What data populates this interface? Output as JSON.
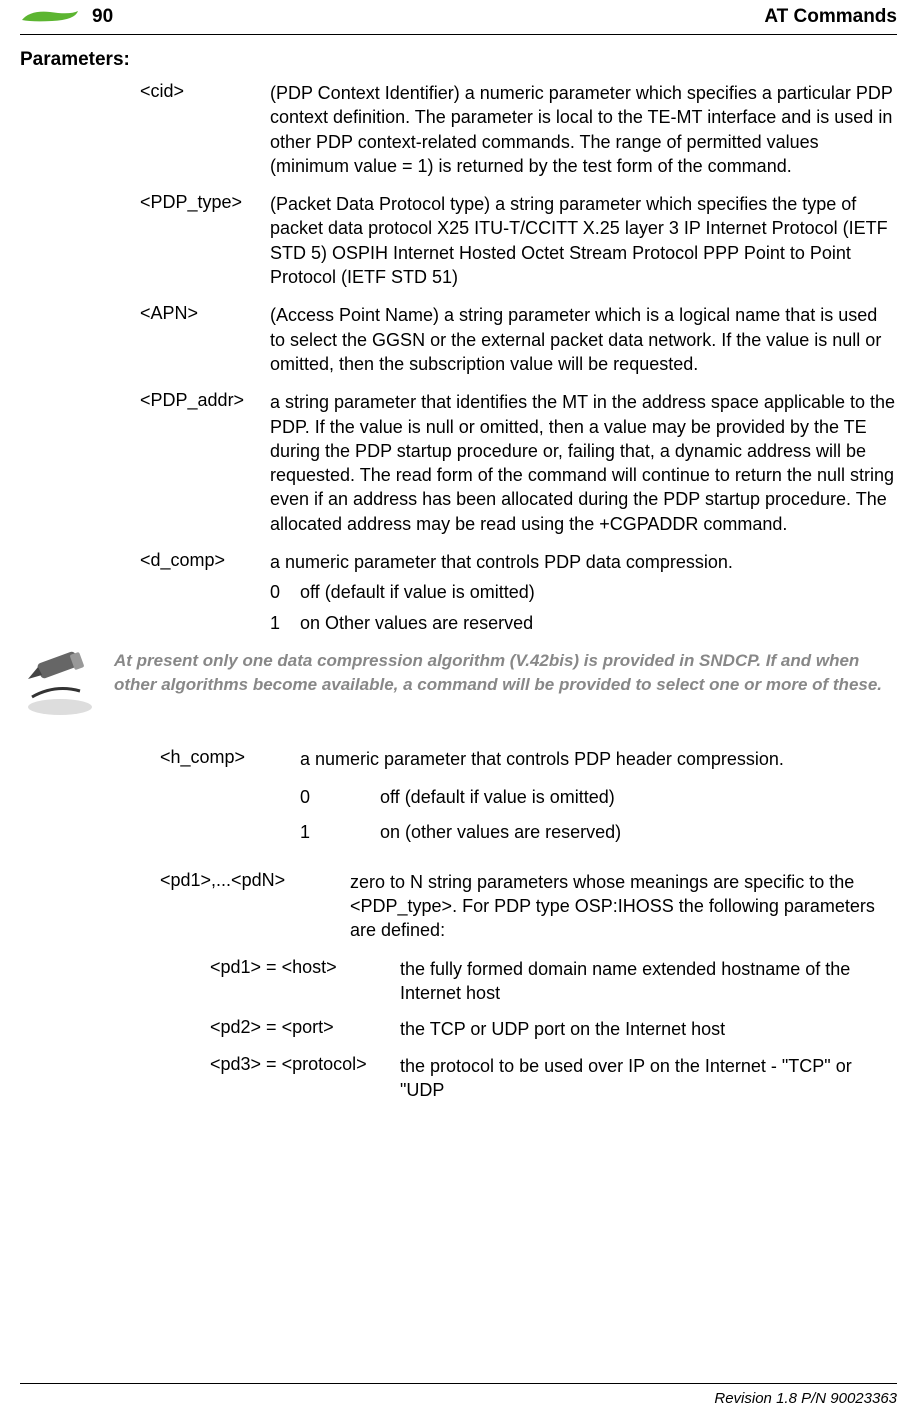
{
  "header": {
    "page_number": "90",
    "section_title": "AT Commands"
  },
  "headings": {
    "parameters": "Parameters:"
  },
  "params": {
    "cid": {
      "name": "<cid>",
      "desc": "(PDP Context Identifier) a numeric parameter which specifies a particular PDP context definition. The parameter is local to the TE-MT interface and is used in other PDP context-related commands. The range of permitted values (minimum value = 1) is returned by the test form of the command."
    },
    "pdp_type": {
      "name": "<PDP_type>",
      "desc": "(Packet Data Protocol type) a string parameter which specifies the type of packet data protocol X25 ITU-T/CCITT X.25 layer 3 IP Internet Protocol (IETF STD 5) OSPIH Internet Hosted Octet Stream Protocol PPP Point to Point Protocol (IETF STD 51)"
    },
    "apn": {
      "name": "<APN>",
      "desc": "(Access Point Name) a string parameter which is a logical name that is used to select the GGSN or the external packet data network. If the value is null or omitted, then the subscription value will be requested."
    },
    "pdp_addr": {
      "name": "<PDP_addr>",
      "desc": "a string parameter that identifies the MT in the address space applicable to the PDP. If the value is null or omitted, then a value may be provided by the TE during the PDP startup procedure or, failing that, a dynamic address will be requested. The read form of the command will continue to return the null string even if an address has been allocated during the PDP startup procedure. The allocated address may be read using the +CGPADDR command."
    },
    "d_comp": {
      "name": "<d_comp>",
      "desc": "a numeric parameter that controls PDP data compression.",
      "v0n": "0",
      "v0t": "off (default if value is omitted)",
      "v1n": "1",
      "v1t": "on Other values are reserved"
    },
    "h_comp": {
      "name": "<h_comp>",
      "desc": "a numeric parameter that controls PDP header compression.",
      "v0n": "0",
      "v0t": "off (default if value is omitted)",
      "v1n": "1",
      "v1t": "on (other values are reserved)"
    },
    "pdn": {
      "name": "<pd1>,...<pdN>",
      "desc": "zero to N string parameters whose meanings are specific to the <PDP_type>. For PDP type OSP:IHOSS the following parameters are defined:",
      "pd1": {
        "name": "<pd1> = <host>",
        "desc": "the fully formed domain name extended hostname of the Internet host"
      },
      "pd2": {
        "name": "<pd2> = <port>",
        "desc": "the TCP or UDP port on the Internet host"
      },
      "pd3": {
        "name": "<pd3> = <protocol>",
        "desc": "the protocol to be used over IP on the Internet - \"TCP\" or \"UDP"
      }
    }
  },
  "note": "At present only one data compression algorithm (V.42bis) is provided in SNDCP. If and when other algorithms become available, a command will be provided to select one or more of these.",
  "footer": "Revision 1.8  P/N 90023363"
}
